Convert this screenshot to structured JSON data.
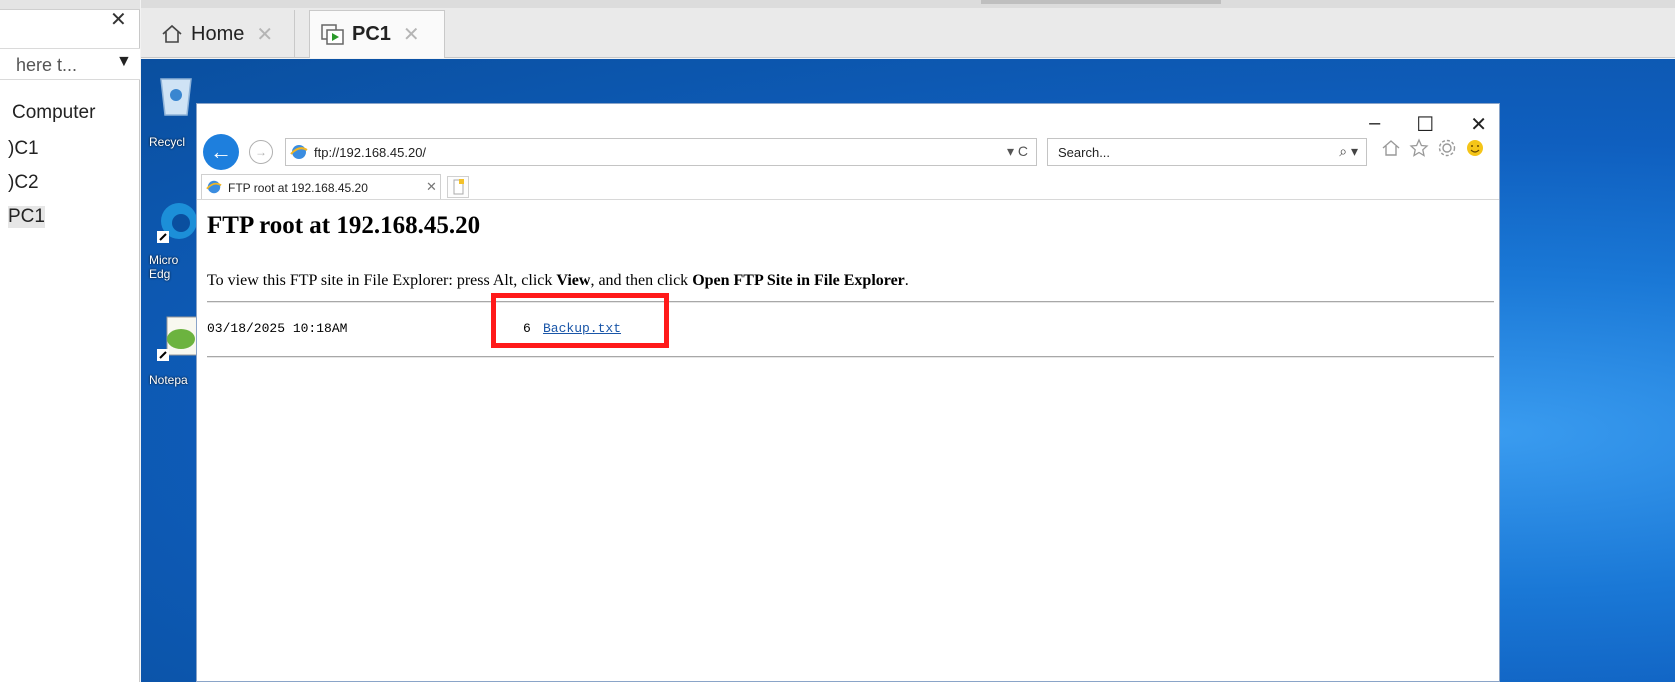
{
  "left_panel": {
    "close": "✕",
    "search_text": "here t...",
    "search_arrow": "▼",
    "items": [
      "Computer",
      ")C1",
      ")C2",
      "PC1"
    ]
  },
  "tabs": [
    {
      "label": "Home",
      "close": "✕"
    },
    {
      "label": "PC1",
      "close": "✕"
    }
  ],
  "desktop": {
    "icons": [
      "Recycl",
      "Micro\nEdg",
      "Notepa"
    ]
  },
  "browser": {
    "minimize": "–",
    "maximize": "☐",
    "close": "✕",
    "back": "←",
    "forward": "→",
    "address": "ftp://192.168.45.20/",
    "address_controls": "▾ C",
    "search_placeholder": "Search...",
    "search_icon": "⌕ ▾",
    "tab_title": "FTP root at 192.168.45.20",
    "tab_close": "✕"
  },
  "page": {
    "title": "FTP root at 192.168.45.20",
    "note_prefix": "To view this FTP site in File Explorer: press Alt, click ",
    "note_view": "View",
    "note_mid": ", and then click ",
    "note_open": "Open FTP Site in File Explorer",
    "note_end": ".",
    "files": [
      {
        "date": "03/18/2025 10:18AM",
        "size": "6",
        "name": "Backup.txt"
      }
    ]
  },
  "colors": {
    "highlight": "#ff1a1a",
    "link": "#1a56a8",
    "desktop_blue": "#1a78d6"
  }
}
